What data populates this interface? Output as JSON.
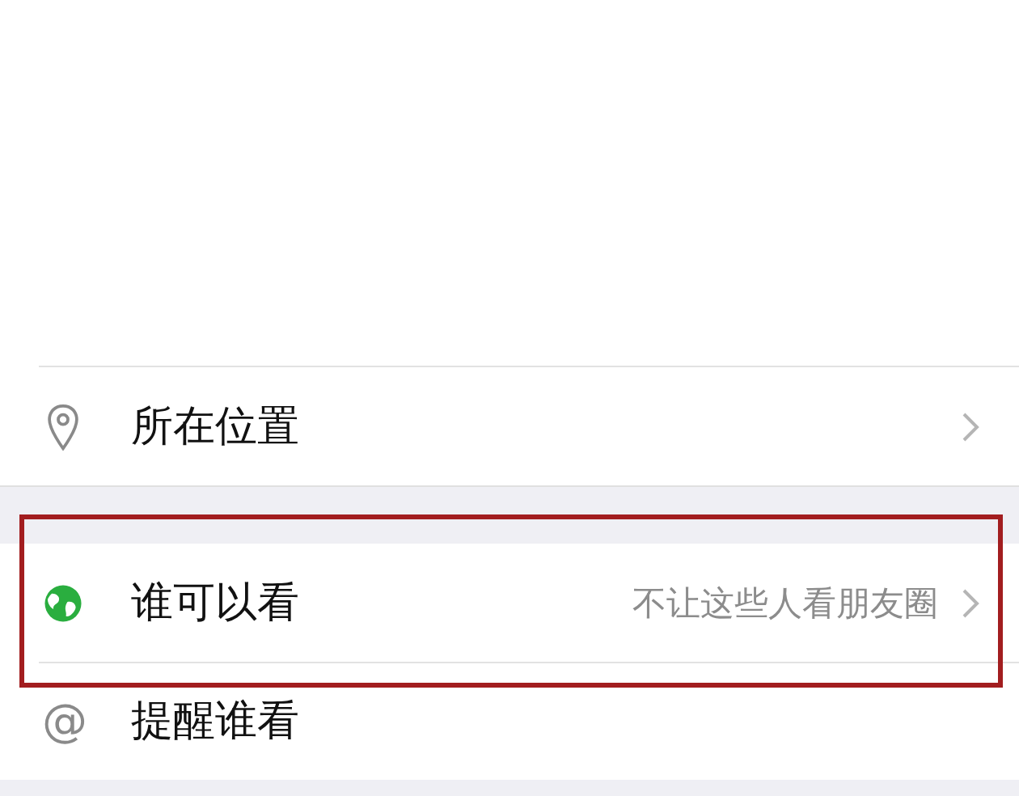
{
  "groups": [
    {
      "rows": [
        {
          "kind": "location",
          "label": "所在位置",
          "chevron": true,
          "highlighted": false
        }
      ]
    },
    {
      "rows": [
        {
          "kind": "visibility",
          "label": "谁可以看",
          "value": "不让这些人看朋友圈",
          "chevron": true,
          "highlighted": true
        },
        {
          "kind": "mention",
          "icon_char": "@",
          "label": "提醒谁看",
          "chevron": false,
          "highlighted": false
        }
      ]
    }
  ]
}
